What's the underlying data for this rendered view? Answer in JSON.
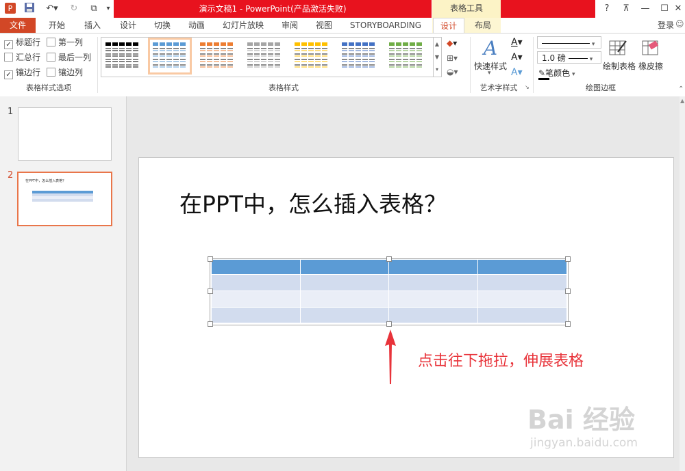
{
  "titlebar": {
    "title": "演示文稿1 - PowerPoint(产品激活失败)",
    "context_header": "表格工具",
    "help": "?",
    "restore_ribbon": "⊼",
    "minimize": "—",
    "maximize": "☐",
    "close": "✕"
  },
  "tabs": {
    "file": "文件",
    "items": [
      "开始",
      "插入",
      "设计",
      "切换",
      "动画",
      "幻灯片放映",
      "审阅",
      "视图",
      "STORYBOARDING"
    ],
    "context_items": [
      "设计",
      "布局"
    ],
    "login": "登录"
  },
  "ribbon": {
    "options": {
      "header_row": "标题行",
      "first_column": "第一列",
      "total_row": "汇总行",
      "last_column": "最后一列",
      "banded_rows": "镶边行",
      "banded_columns": "镶边列",
      "group_label": "表格样式选项",
      "header_row_checked": true,
      "total_row_checked": false,
      "banded_rows_checked": true,
      "first_column_checked": false,
      "last_column_checked": false,
      "banded_columns_checked": false
    },
    "styles": {
      "group_label": "表格样式",
      "thumb_colors": [
        "#000000",
        "#5b9bd5",
        "#ed7d31",
        "#a5a5a5",
        "#ffc000",
        "#4472c4",
        "#70ad47"
      ],
      "selected_index": 1
    },
    "wordart": {
      "quick_styles": "快速样式",
      "group_label": "艺术字样式"
    },
    "borders": {
      "pen_weight": "1.0 磅",
      "pen_color": "笔颜色",
      "draw_table": "绘制表格",
      "eraser": "橡皮擦",
      "group_label": "绘图边框"
    }
  },
  "slides": {
    "thumb1_number": "1",
    "thumb2_number": "2",
    "thumb2_title": "在PPT中，怎么插入表格？"
  },
  "slide": {
    "title": "在PPT中，怎么插入表格？",
    "annotation": "点击往下拖拉，伸展表格",
    "table": {
      "rows": 4,
      "cols": 4,
      "header_color": "#5b9bd5",
      "band_color": "#d2dcee",
      "alt_color": "#eaeef7"
    }
  },
  "watermark": {
    "brand": "Bai 经验",
    "url": "jingyan.baidu.com"
  },
  "colors": {
    "accent": "#d24726",
    "title_red": "#e8121e",
    "annotation_red": "#e8333a"
  }
}
